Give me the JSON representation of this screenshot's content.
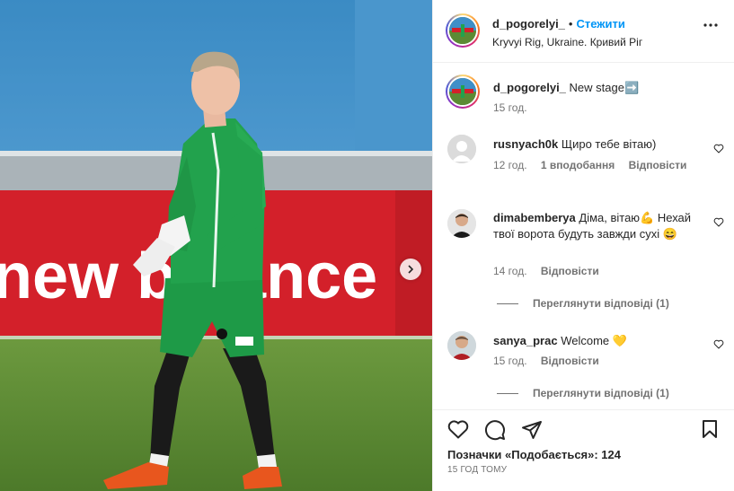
{
  "post": {
    "username": "d_pogorelyi_",
    "follow_label": "Стежити",
    "location": "Kryvyi Rig, Ukraine. Кривий Ріг",
    "caption": "New stage",
    "caption_emoji": "➡️",
    "caption_time": "15 год."
  },
  "photo": {
    "ad_text": "new balance",
    "next_icon": "chevron-right-icon"
  },
  "comments": [
    {
      "username": "rusnyach0k",
      "text": "Щиро тебе вітаю)",
      "time": "12 год.",
      "likes": "1 вподобання",
      "reply": "Відповісти"
    },
    {
      "username": "dimabemberya",
      "text": "Діма, вітаю💪 Нехай твої ворота будуть завжди сухі 😄",
      "time": "14 год.",
      "reply": "Відповісти",
      "view_replies": "Переглянути відповіді (1)"
    },
    {
      "username": "sanya_prac",
      "text": "Welcome 💛",
      "time": "15 год.",
      "reply": "Відповісти",
      "view_replies": "Переглянути відповіді (1)"
    }
  ],
  "actions": {
    "likes": "Позначки «Подобається»: 124",
    "time_ago": "15 ГОД ТОМУ"
  },
  "colors": {
    "accent": "#0095f6",
    "muted": "#737373",
    "text": "#262626",
    "border": "#efefef"
  }
}
